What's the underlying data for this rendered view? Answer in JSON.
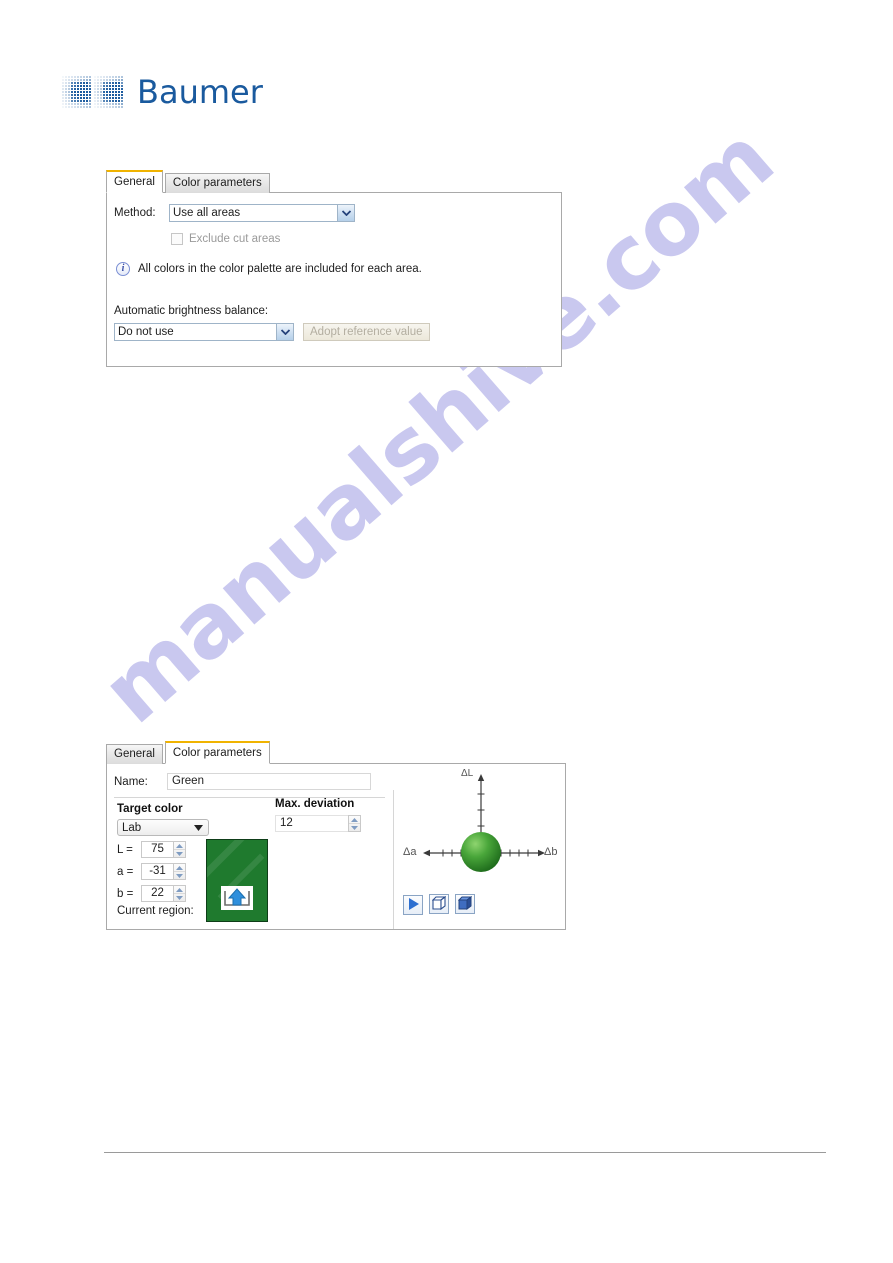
{
  "brand": {
    "name": "Baumer",
    "logo_icon": "baumer-dither-logo",
    "color": "#1a5a9e"
  },
  "watermark": {
    "text": "manualshive.com",
    "color": "#c9c8ef"
  },
  "dialog_general": {
    "tabs": [
      {
        "label": "General",
        "active": true
      },
      {
        "label": "Color parameters",
        "active": false
      }
    ],
    "method": {
      "label": "Method:",
      "value": "Use all areas",
      "arrow_icon": "chevron-down-icon"
    },
    "exclude_cut_areas": {
      "label": "Exclude cut areas",
      "checked": false,
      "disabled": true
    },
    "info": {
      "icon": "info-icon",
      "text": "All colors in the color palette are included for each area."
    },
    "brightness": {
      "label": "Automatic brightness balance:",
      "value": "Do not use",
      "arrow_icon": "chevron-down-icon",
      "adopt_button": "Adopt reference value",
      "adopt_disabled": true
    }
  },
  "dialog_color_parameters": {
    "tabs": [
      {
        "label": "General",
        "active": false
      },
      {
        "label": "Color parameters",
        "active": true
      }
    ],
    "name_field": {
      "label": "Name:",
      "value": "Green",
      "placeholder": ""
    },
    "target_color": {
      "heading": "Target color",
      "space": "Lab",
      "space_arrow_icon": "chevron-down-icon",
      "channels": [
        {
          "label": "L =",
          "value": "75"
        },
        {
          "label": "a =",
          "value": "-31"
        },
        {
          "label": "b =",
          "value": "22"
        }
      ],
      "current_region_label": "Current region:",
      "swatch_color": "#1f7a2e",
      "swatch_badge_icon": "upload-arrow-icon"
    },
    "max_deviation": {
      "heading": "Max. deviation",
      "value": "12"
    },
    "plot": {
      "axis_l": "ΔL",
      "axis_a": "Δa",
      "axis_b": "Δb",
      "sphere_color": "#3f9e34"
    },
    "toolbar": [
      {
        "icon": "play-icon",
        "name": "animate-button"
      },
      {
        "icon": "cube-wireframe-icon",
        "name": "wireframe-cube-button"
      },
      {
        "icon": "cube-solid-icon",
        "name": "solid-cube-button"
      }
    ]
  }
}
